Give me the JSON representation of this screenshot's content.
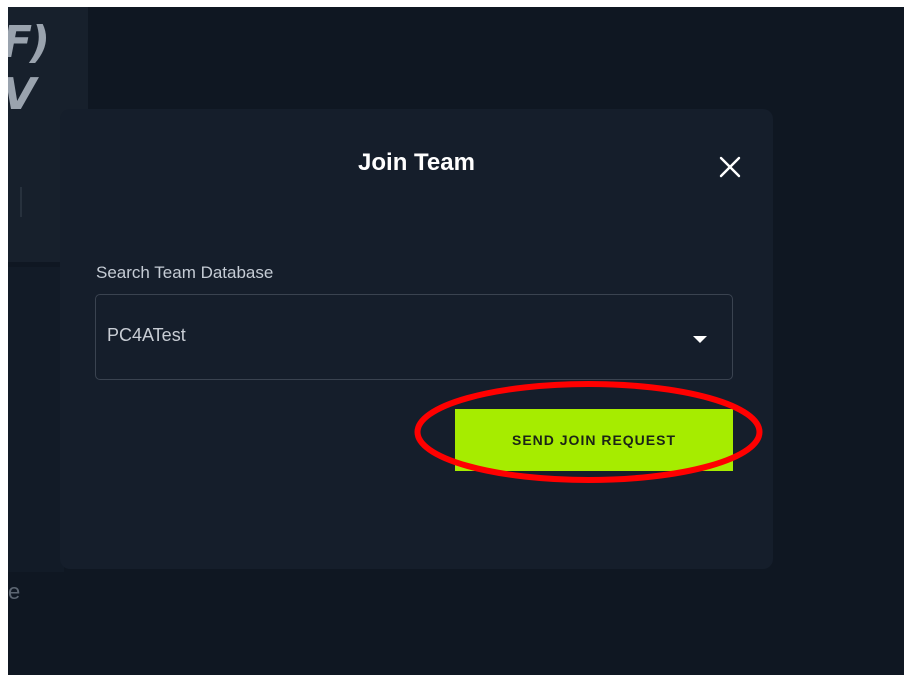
{
  "background": {
    "partial_text_1": "F)",
    "partial_text_2": "V",
    "partial_letter": "e"
  },
  "modal": {
    "title": "Join Team",
    "close_icon": "close-icon",
    "search_label": "Search Team Database",
    "selected_team": "PC4ATest",
    "dropdown_icon": "caret-down-icon",
    "submit_label": "SEND JOIN REQUEST"
  },
  "annotation": {
    "highlight_color": "#ff0000"
  },
  "colors": {
    "page_bg": "#0f1722",
    "modal_bg": "#151e2b",
    "accent": "#a6ec00"
  }
}
